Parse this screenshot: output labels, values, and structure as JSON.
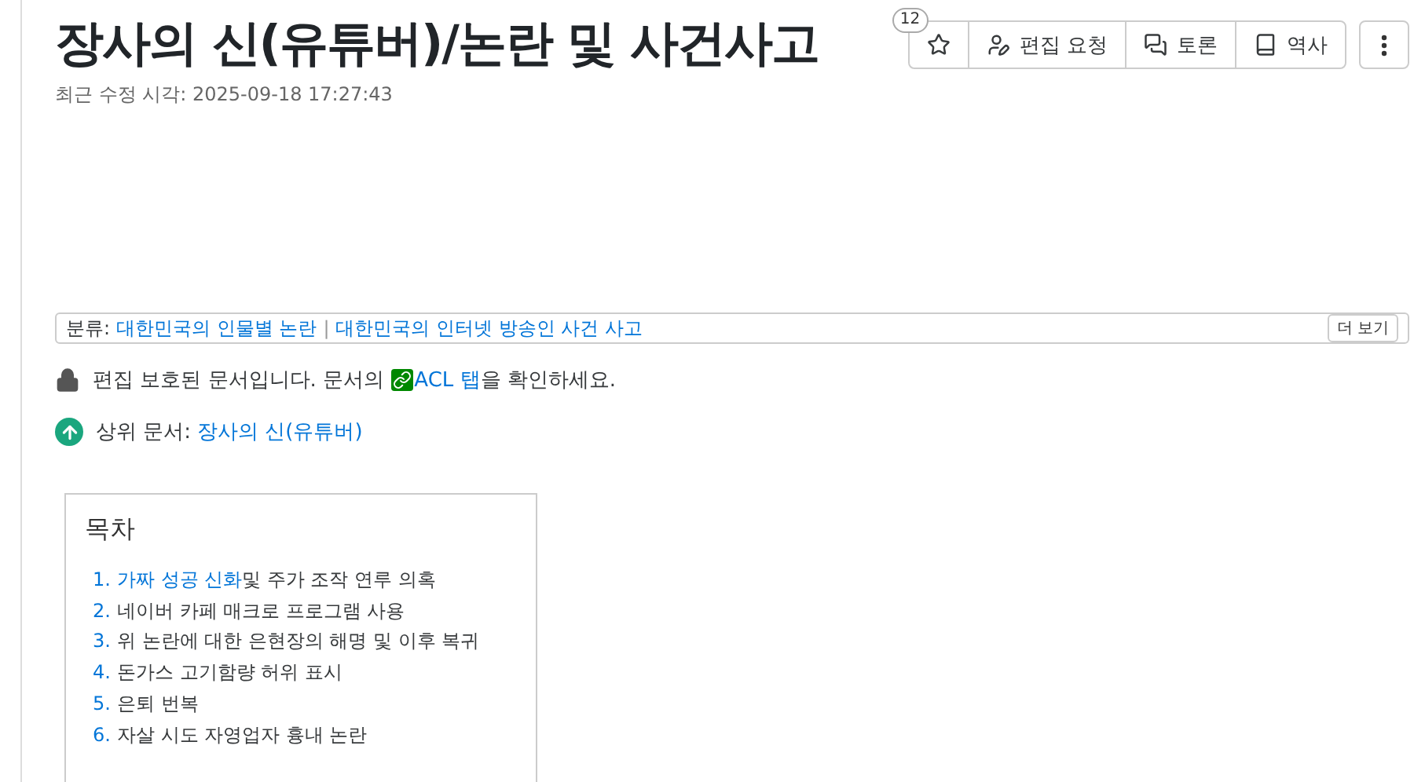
{
  "title": "장사의 신(유튜버)/논란 및 사건사고",
  "modified": "최근 수정 시각: 2025-09-18 17:27:43",
  "star_count": "12",
  "actions": [
    {
      "kind": "star"
    },
    {
      "kind": "edit",
      "label": "편집 요청"
    },
    {
      "kind": "discuss",
      "label": "토론"
    },
    {
      "kind": "history",
      "label": "역사"
    }
  ],
  "categories": {
    "label": "분류:",
    "items": [
      "대한민국의 인물별 논란",
      "대한민국의 인터넷 방송인 사건 사고"
    ],
    "separator": "|",
    "more": "더 보기"
  },
  "protection": {
    "before": "편집 보호된 문서입니다. 문서의 ",
    "link": "ACL 탭",
    "after": "을 확인하세요."
  },
  "parent": {
    "label": "상위 문서:",
    "link": "장사의 신(유튜버)"
  },
  "toc": {
    "title": "목차",
    "items": [
      {
        "number": "1.",
        "link": "가짜 성공 신화",
        "text": " 및 주가 조작 연루 의혹"
      },
      {
        "number": "2.",
        "text": "네이버 카페 매크로 프로그램 사용"
      },
      {
        "number": "3.",
        "text": "위 논란에 대한 은현장의 해명 및 이후 복귀"
      },
      {
        "number": "4.",
        "text": "돈가스 고기함량 허위 표시"
      },
      {
        "number": "5.",
        "text": "은퇴 번복"
      },
      {
        "number": "6.",
        "text": "자살 시도 자영업자 흉내 논란"
      }
    ]
  }
}
